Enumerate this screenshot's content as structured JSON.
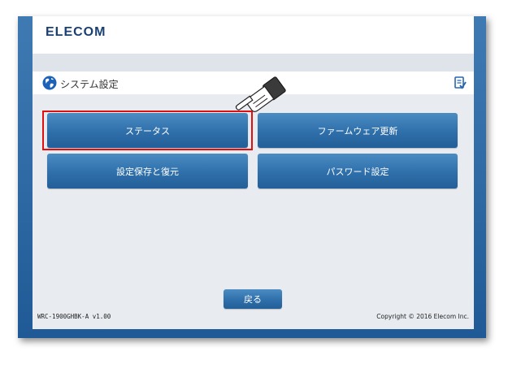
{
  "brand": {
    "logo_text": "ELECOM"
  },
  "title_bar": {
    "title": "システム設定",
    "left_icon": "globe-icon",
    "right_icon": "help-document-icon"
  },
  "menu": {
    "buttons": [
      {
        "label": "ステータス",
        "highlighted": true
      },
      {
        "label": "ファームウェア更新"
      },
      {
        "label": "設定保存と復元"
      },
      {
        "label": "パスワード設定"
      }
    ]
  },
  "back_label": "戻る",
  "footer": {
    "version": "WRC-1900GHBK-A v1.00",
    "copyright": "Copyright © 2016 Elecom Inc."
  },
  "colors": {
    "frame_blue": "#2f6ba7",
    "button_blue": "#2f6faa",
    "highlight_red": "#e01010",
    "logo_navy": "#1a3f73"
  },
  "cursor_icon": "pointing-hand-icon"
}
